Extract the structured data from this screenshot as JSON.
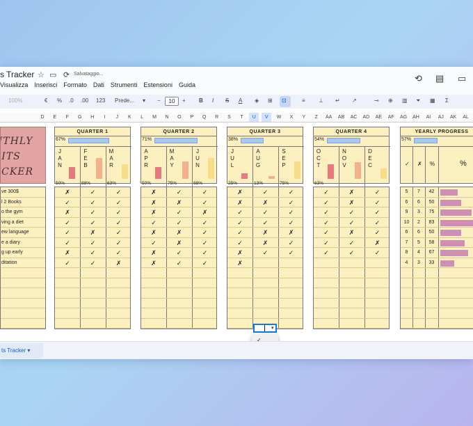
{
  "window": {
    "doc_title": "s Tracker",
    "saving": "Salvataggio...",
    "menu": [
      "Visualizza",
      "Inserisci",
      "Formato",
      "Dati",
      "Strumenti",
      "Estensioni",
      "Guida"
    ]
  },
  "toolbar": {
    "zoom": "100%",
    "currency": "€",
    "percent": "%",
    "dec_less": ".0",
    "dec_more": ".00",
    "num_format": "123",
    "font": "Prede...",
    "font_minus": "−",
    "font_size": "10",
    "font_plus": "+",
    "bold": "B",
    "italic": "I",
    "strike": "S",
    "text_color": "A",
    "sigma": "Σ"
  },
  "columns": [
    "D",
    "E",
    "F",
    "G",
    "H",
    "I",
    "J",
    "K",
    "L",
    "M",
    "N",
    "O",
    "P",
    "Q",
    "R",
    "S",
    "T",
    "U",
    "V",
    "W",
    "X",
    "Y",
    "Z",
    "AA",
    "AB",
    "AC",
    "AD",
    "AE",
    "AF",
    "AG",
    "AH",
    "AI",
    "AJ",
    "AK",
    "AL"
  ],
  "title_text": [
    "NTHLY",
    "BITS",
    "ACKER"
  ],
  "quarters": [
    {
      "title": "QUARTER 1",
      "pct": "67%",
      "progress": 0.67,
      "months": [
        {
          "letters": [
            "J",
            "A",
            "N"
          ],
          "pct": "50%",
          "value": 0.5,
          "color": "#e8797e"
        },
        {
          "letters": [
            "F",
            "E",
            "B"
          ],
          "pct": "88%",
          "value": 0.88,
          "color": "#f2b08d"
        },
        {
          "letters": [
            "M",
            "A",
            "R"
          ],
          "pct": "63%",
          "value": 0.63,
          "color": "#f7dc8a"
        }
      ]
    },
    {
      "title": "QUARTER 2",
      "pct": "71%",
      "progress": 0.71,
      "months": [
        {
          "letters": [
            "A",
            "P",
            "R"
          ],
          "pct": "50%",
          "value": 0.5,
          "color": "#e8797e"
        },
        {
          "letters": [
            "M",
            "A",
            "Y"
          ],
          "pct": "75%",
          "value": 0.75,
          "color": "#f2b08d"
        },
        {
          "letters": [
            "J",
            "U",
            "N"
          ],
          "pct": "88%",
          "value": 0.88,
          "color": "#f7dc8a"
        }
      ]
    },
    {
      "title": "QUARTER 3",
      "pct": "38%",
      "progress": 0.38,
      "months": [
        {
          "letters": [
            "J",
            "U",
            "L"
          ],
          "pct": "25%",
          "value": 0.25,
          "color": "#e8797e"
        },
        {
          "letters": [
            "A",
            "U",
            "G"
          ],
          "pct": "13%",
          "value": 0.13,
          "color": "#f2b08d"
        },
        {
          "letters": [
            "S",
            "E",
            "P"
          ],
          "pct": "75%",
          "value": 0.75,
          "color": "#f7dc8a"
        }
      ]
    },
    {
      "title": "QUARTER 4",
      "pct": "54%",
      "progress": 0.54,
      "months": [
        {
          "letters": [
            "O",
            "C",
            "T"
          ],
          "pct": "63%",
          "value": 0.63,
          "color": "#e8797e"
        },
        {
          "letters": [
            "N",
            "O",
            "V"
          ],
          "pct": "",
          "value": 0.7,
          "color": "#f2b08d"
        },
        {
          "letters": [
            "D",
            "E",
            "C"
          ],
          "pct": "",
          "value": 0.45,
          "color": "#f7dc8a"
        }
      ]
    }
  ],
  "yearly": {
    "title": "YEARLY PROGRESS",
    "pct": "57%",
    "progress": 0.57,
    "headers": [
      "✓",
      "✗",
      "%",
      "%"
    ]
  },
  "habits": [
    {
      "name": "ve 300$",
      "marks": [
        "✗",
        "✓",
        "✓",
        "✗",
        "✓",
        "✓",
        "✗",
        "✓",
        "✓",
        "✓",
        "✗",
        "✓"
      ],
      "done": "5",
      "missed": "7",
      "pct": "42",
      "ratio": 0.42
    },
    {
      "name": "l 2 Books",
      "marks": [
        "✓",
        "✓",
        "✓",
        "✗",
        "✗",
        "✓",
        "✗",
        "✗",
        "✓",
        "✓",
        "✗",
        "✓"
      ],
      "done": "6",
      "missed": "6",
      "pct": "50",
      "ratio": 0.5
    },
    {
      "name": "o the gym",
      "marks": [
        "✗",
        "✓",
        "✓",
        "✗",
        "✓",
        "✗",
        "✓",
        "✓",
        "✓",
        "✓",
        "✓",
        "✓"
      ],
      "done": "9",
      "missed": "3",
      "pct": "75",
      "ratio": 0.75
    },
    {
      "name": "ving a diet",
      "marks": [
        "✓",
        "✓",
        "✓",
        "✓",
        "✓",
        "✓",
        "✓",
        "✓",
        "✓",
        "✓",
        "✓",
        "✓"
      ],
      "done": "10",
      "missed": "2",
      "pct": "83",
      "ratio": 0.83
    },
    {
      "name": "ew language",
      "marks": [
        "✓",
        "✗",
        "✓",
        "✗",
        "✗",
        "✓",
        "✓",
        "✗",
        "✗",
        "✓",
        "✗",
        "✓"
      ],
      "done": "6",
      "missed": "6",
      "pct": "50",
      "ratio": 0.5
    },
    {
      "name": "e a diary",
      "marks": [
        "✓",
        "✓",
        "✓",
        "✓",
        "✗",
        "✓",
        "✓",
        "✗",
        "✓",
        "✓",
        "✓",
        "✗"
      ],
      "done": "7",
      "missed": "5",
      "pct": "58",
      "ratio": 0.58
    },
    {
      "name": "g up early",
      "marks": [
        "✗",
        "✓",
        "✓",
        "✗",
        "✓",
        "✓",
        "✗",
        "✓",
        "✓",
        "✓",
        "✓",
        "✓"
      ],
      "done": "8",
      "missed": "4",
      "pct": "67",
      "ratio": 0.67
    },
    {
      "name": "ditation",
      "marks": [
        "✓",
        "✓",
        "✗",
        "✗",
        "✓",
        "✓",
        "✗",
        "",
        "",
        "",
        "",
        ""
      ],
      "done": "4",
      "missed": "3",
      "pct": "33",
      "ratio": 0.33
    }
  ],
  "dropdown": {
    "options": [
      "✓",
      "✗",
      "✎"
    ]
  },
  "sheet_tab": "ts Tracker ▾"
}
